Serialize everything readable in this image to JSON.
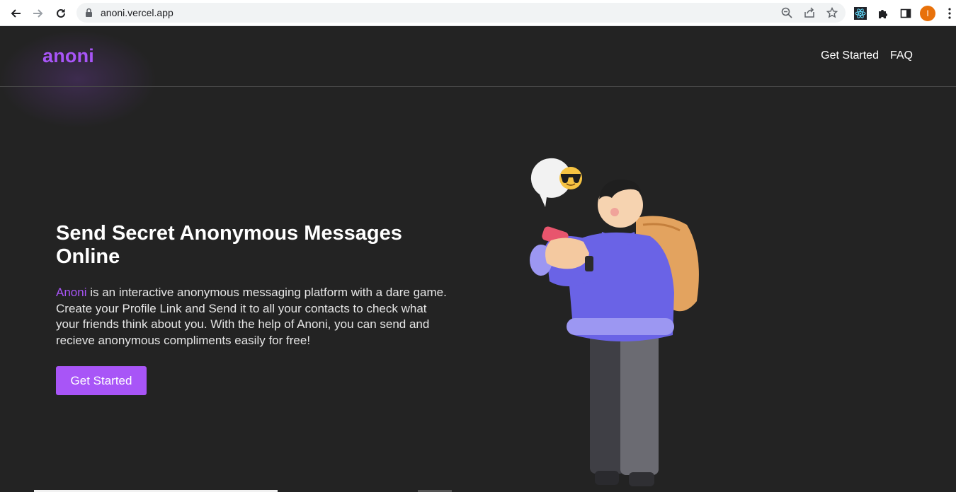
{
  "browser": {
    "url": "anoni.vercel.app",
    "profile_initial": "I"
  },
  "site": {
    "logo": "anoni",
    "nav": [
      "Get Started",
      "FAQ"
    ]
  },
  "hero": {
    "title": "Send Secret Anonymous Messages Online",
    "brand_word": "Anoni",
    "description": " is an interactive anonymous messaging platform with a dare game. Create your Profile Link and Send it to all your contacts to check what your friends think about you. With the help of Anoni, you can send and recieve anonymous compliments easily for free!",
    "cta_label": "Get Started"
  },
  "colors": {
    "accent": "#a855f7",
    "background": "#232323"
  }
}
